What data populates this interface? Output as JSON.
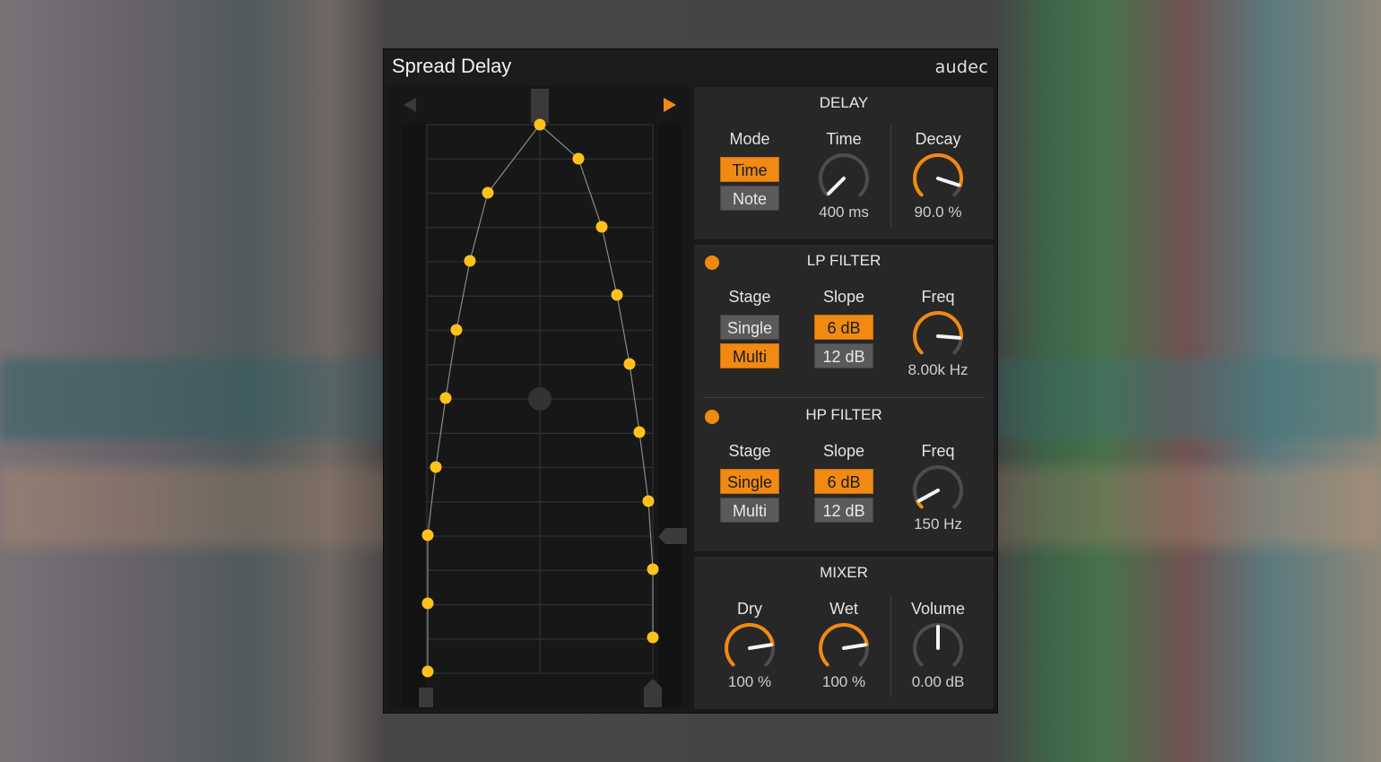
{
  "plugin": {
    "title": "Spread Delay",
    "brand": "audec"
  },
  "colors": {
    "accent": "#f08a12",
    "dot": "#ffc21a",
    "panel": "#272727",
    "background": "#1a1a1a"
  },
  "graph": {
    "icons": {
      "left": "triangle-left-icon",
      "right": "triangle-right-icon"
    }
  },
  "delay": {
    "title": "DELAY",
    "mode": {
      "label": "Mode",
      "options": [
        "Time",
        "Note"
      ],
      "selected": "Time"
    },
    "time": {
      "label": "Time",
      "value": "400 ms",
      "level": 0.0
    },
    "decay": {
      "label": "Decay",
      "value": "90.0 %",
      "level": 0.9
    }
  },
  "lp_filter": {
    "title": "LP FILTER",
    "enabled": true,
    "stage": {
      "label": "Stage",
      "options": [
        "Single",
        "Multi"
      ],
      "selected": "Multi"
    },
    "slope": {
      "label": "Slope",
      "options": [
        "6 dB",
        "12 dB"
      ],
      "selected": "6 dB"
    },
    "freq": {
      "label": "Freq",
      "value": "8.00k Hz",
      "level": 0.85
    }
  },
  "hp_filter": {
    "title": "HP FILTER",
    "enabled": true,
    "stage": {
      "label": "Stage",
      "options": [
        "Single",
        "Multi"
      ],
      "selected": "Single"
    },
    "slope": {
      "label": "Slope",
      "options": [
        "6 dB",
        "12 dB"
      ],
      "selected": "6 dB"
    },
    "freq": {
      "label": "Freq",
      "value": "150 Hz",
      "level": 0.06
    }
  },
  "mixer": {
    "title": "MIXER",
    "dry": {
      "label": "Dry",
      "value": "100 %",
      "level": 0.8
    },
    "wet": {
      "label": "Wet",
      "value": "100 %",
      "level": 0.8
    },
    "volume": {
      "label": "Volume",
      "value": "0.00 dB",
      "level": 0.5
    }
  }
}
